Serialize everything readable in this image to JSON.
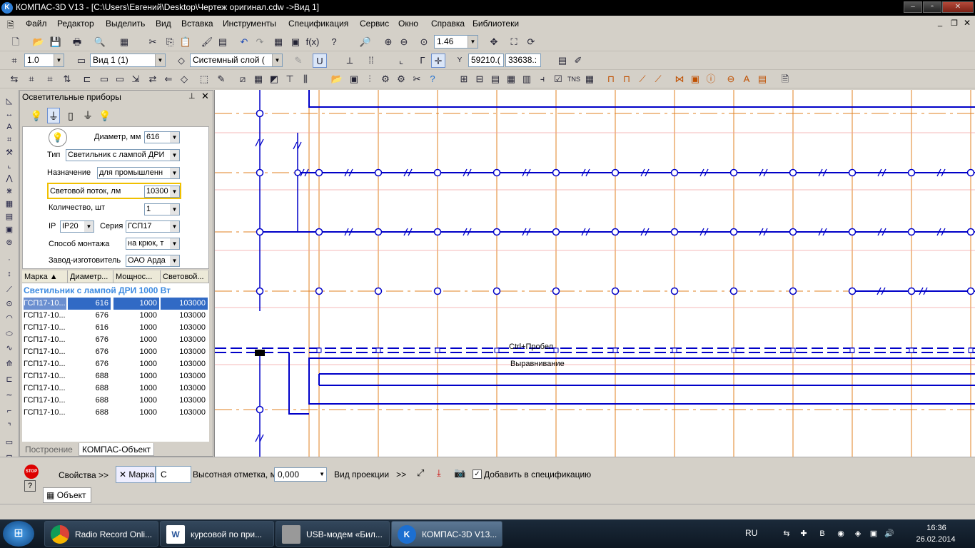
{
  "window": {
    "title": "КОМПАС-3D V13 - [C:\\Users\\Евгений\\Desktop\\Чертеж оригинал.cdw ->Вид 1]"
  },
  "menu": [
    "Файл",
    "Редактор",
    "Выделить",
    "Вид",
    "Вставка",
    "Инструменты",
    "Спецификация",
    "Сервис",
    "Окно",
    "Справка",
    "Библиотеки"
  ],
  "toolbar1": {
    "zoom": "1.46"
  },
  "toolbar2": {
    "scale": "1.0",
    "view": "Вид 1 (1)",
    "layer": "Системный слой (",
    "coord_x": "59210.(",
    "coord_y": "33638.:"
  },
  "panel": {
    "title": "Осветительные приборы",
    "form": {
      "diameter_label": "Диаметр, мм",
      "diameter": "616",
      "type_label": "Тип",
      "type": "Светильник с лампой ДРИ",
      "purpose_label": "Назначение",
      "purpose": "для промышленн",
      "flux_label": "Световой поток, лм",
      "flux": "10300",
      "qty_label": "Количество, шт",
      "qty": "1",
      "ip_label": "IP",
      "ip": "IP20",
      "series_label": "Серия",
      "series": "ГСП17",
      "mount_label": "Способ монтажа",
      "mount": "на крюк, т",
      "maker_label": "Завод-изготовитель",
      "maker": "ОАО Арда"
    },
    "table": {
      "headers": [
        "Марка",
        "Диаметр...",
        "Мощнос...",
        "Световой..."
      ],
      "group": "Светильник с лампой ДРИ 1000 Вт",
      "rows": [
        [
          "ГСП17-10...",
          "616",
          "1000",
          "103000"
        ],
        [
          "ГСП17-10...",
          "676",
          "1000",
          "103000"
        ],
        [
          "ГСП17-10...",
          "616",
          "1000",
          "103000"
        ],
        [
          "ГСП17-10...",
          "676",
          "1000",
          "103000"
        ],
        [
          "ГСП17-10...",
          "676",
          "1000",
          "103000"
        ],
        [
          "ГСП17-10...",
          "676",
          "1000",
          "103000"
        ],
        [
          "ГСП17-10...",
          "688",
          "1000",
          "103000"
        ],
        [
          "ГСП17-10...",
          "688",
          "1000",
          "103000"
        ],
        [
          "ГСП17-10...",
          "688",
          "1000",
          "103000"
        ],
        [
          "ГСП17-10...",
          "688",
          "1000",
          "103000"
        ]
      ]
    },
    "tabs": [
      "Построение",
      "КОМПАС-Объект"
    ]
  },
  "canvas": {
    "hint1": "Ctrl+Пробел",
    "hint2": "Выравнивание"
  },
  "props": {
    "properties": "Свойства",
    "mark_label": "Марка",
    "mark_value": "С",
    "height_label": "Высотная отметка, м",
    "height_value": "0,000",
    "projection": "Вид проекции",
    "add_spec": "Добавить в спецификацию",
    "tab": "Объект",
    "stop": "STOP"
  },
  "taskbar": {
    "tasks": [
      "Radio Record Onli...",
      "курсовой по при...",
      "USB-модем «Бил...",
      "КОМПАС-3D V13..."
    ],
    "lang": "RU",
    "time": "16:36",
    "date": "26.02.2014"
  },
  "colors": {
    "accent": "#316ac5",
    "drawing_blue": "#0000c8",
    "drawing_orange": "#e08020"
  }
}
